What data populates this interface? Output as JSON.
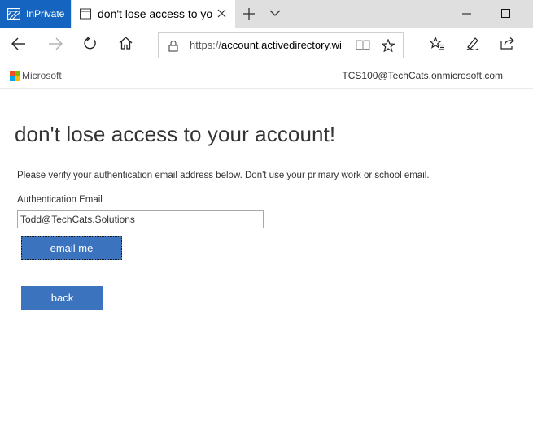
{
  "browser": {
    "inprivate_label": "InPrivate",
    "tab_title": "don't lose access to you",
    "address": {
      "scheme": "https://",
      "host": "account.activedirectory.wi"
    }
  },
  "header": {
    "brand": "Microsoft",
    "user": "TCS100@TechCats.onmicrosoft.com"
  },
  "page": {
    "title": "don't lose access to your account!",
    "intro": "Please verify your authentication email address below. Don't use your primary work or school email.",
    "email_label": "Authentication Email",
    "email_value": "Todd@TechCats.Solutions",
    "email_button": "email me",
    "back_button": "back"
  },
  "colors": {
    "inprivate_bg": "#1565c0",
    "button_bg": "#3b73bf",
    "ms_red": "#f25022",
    "ms_green": "#7fba00",
    "ms_blue": "#00a4ef",
    "ms_yellow": "#ffb900"
  },
  "icons": [
    "inprivate-icon",
    "page-icon",
    "tab-close-icon",
    "new-tab-icon",
    "tab-list-chevron-icon",
    "minimize-icon",
    "maximize-icon",
    "back-arrow-icon",
    "forward-arrow-icon",
    "refresh-icon",
    "home-icon",
    "lock-icon",
    "reading-view-icon",
    "favorite-star-icon",
    "favorites-hub-icon",
    "pen-icon",
    "share-icon"
  ]
}
